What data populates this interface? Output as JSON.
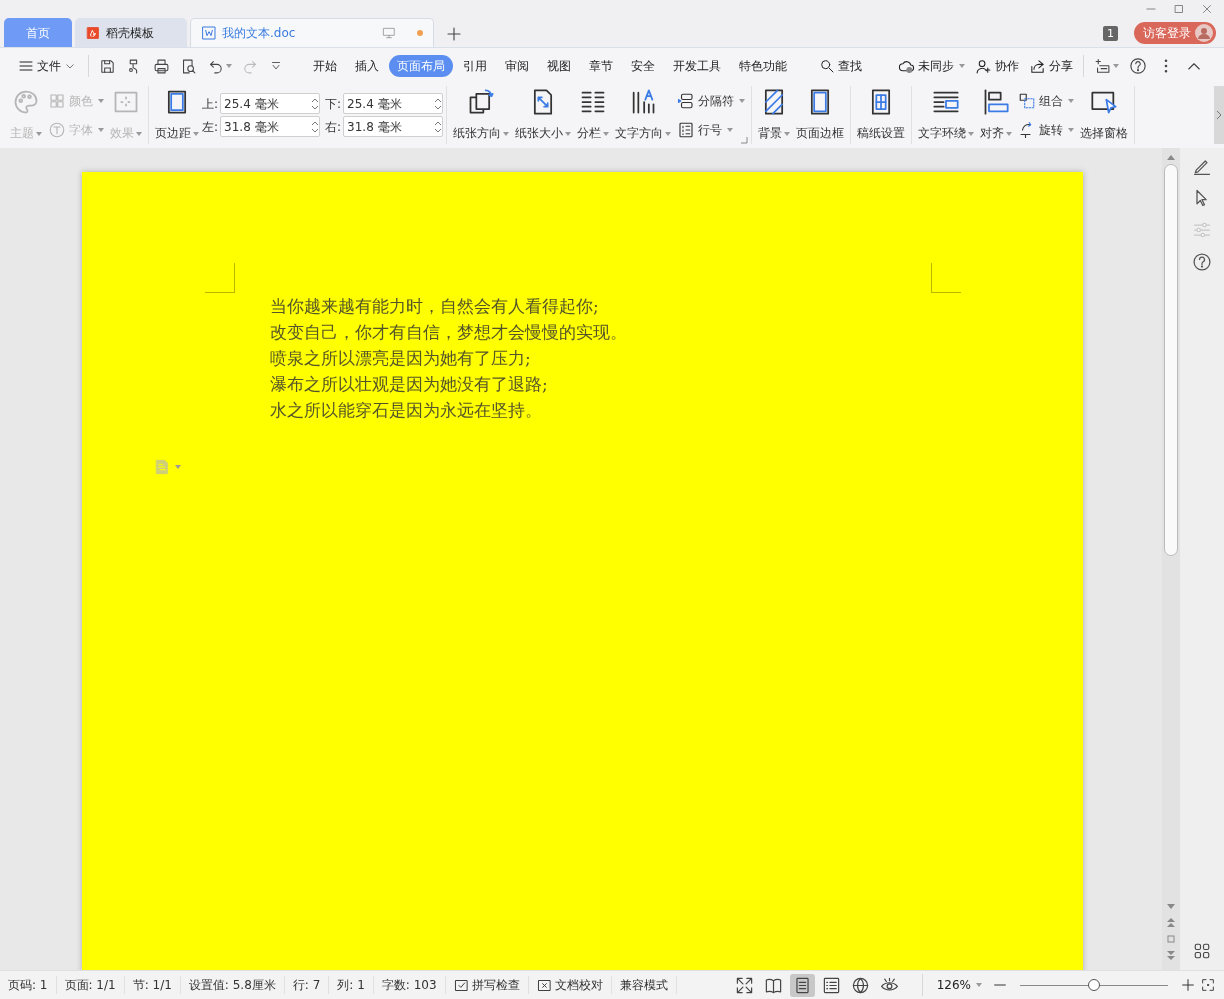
{
  "title_bar": {
    "tabs": [
      {
        "label": "首页",
        "kind": "home",
        "selected": false
      },
      {
        "label": "稻壳模板",
        "kind": "template",
        "selected": false
      },
      {
        "label": "我的文本.doc",
        "kind": "document",
        "selected": true,
        "unsaved": true
      }
    ],
    "badge": "1",
    "login_button": "访客登录"
  },
  "menu_bar": {
    "file_menu": "文件",
    "tabs": [
      {
        "label": "开始",
        "selected": false
      },
      {
        "label": "插入",
        "selected": false
      },
      {
        "label": "页面布局",
        "selected": true
      },
      {
        "label": "引用",
        "selected": false
      },
      {
        "label": "审阅",
        "selected": false
      },
      {
        "label": "视图",
        "selected": false
      },
      {
        "label": "章节",
        "selected": false
      },
      {
        "label": "安全",
        "selected": false
      },
      {
        "label": "开发工具",
        "selected": false
      },
      {
        "label": "特色功能",
        "selected": false
      }
    ],
    "search": "查找",
    "actions": [
      {
        "label": "未同步",
        "kind": "sync",
        "dropdown": true
      },
      {
        "label": "协作",
        "kind": "collab",
        "dropdown": false
      },
      {
        "label": "分享",
        "kind": "share",
        "dropdown": false
      }
    ]
  },
  "ribbon": {
    "groups": [
      {
        "launcher": false,
        "items": [
          {
            "kind": "palette",
            "label": "主题",
            "dropdown": true,
            "disabled": true
          },
          {
            "rows": [
              {
                "kind": "grid",
                "label": "颜色",
                "dropdown": true,
                "disabled": true
              },
              {
                "kind": "font",
                "label": "字体",
                "dropdown": true,
                "disabled": true
              }
            ]
          },
          {
            "kind": "effect",
            "label": "效果",
            "dropdown": true,
            "disabled": true
          }
        ]
      },
      {
        "launcher": false,
        "items": [
          {
            "kind": "margins",
            "label": "页边距",
            "dropdown": true,
            "disabled": false
          },
          {
            "fields": [
              {
                "label": "上:",
                "value": "25.4 毫米"
              },
              {
                "label": "下:",
                "value": "25.4 毫米"
              },
              {
                "label": "左:",
                "value": "31.8 毫米"
              },
              {
                "label": "右:",
                "value": "31.8 毫米"
              }
            ]
          }
        ]
      },
      {
        "launcher": true,
        "items": [
          {
            "kind": "orientation",
            "label": "纸张方向",
            "dropdown": true,
            "disabled": false
          },
          {
            "kind": "size",
            "label": "纸张大小",
            "dropdown": true,
            "disabled": false
          },
          {
            "kind": "columns",
            "label": "分栏",
            "dropdown": true,
            "disabled": false
          },
          {
            "kind": "textdir",
            "label": "文字方向",
            "dropdown": true,
            "disabled": false
          },
          {
            "rows": [
              {
                "kind": "separator",
                "label": "分隔符",
                "dropdown": true,
                "disabled": false
              },
              {
                "kind": "linenum",
                "label": "行号",
                "dropdown": true,
                "disabled": false
              }
            ]
          }
        ]
      },
      {
        "launcher": false,
        "items": [
          {
            "kind": "background",
            "label": "背景",
            "dropdown": true,
            "disabled": false
          },
          {
            "kind": "border",
            "label": "页面边框",
            "dropdown": false,
            "disabled": false
          }
        ]
      },
      {
        "launcher": false,
        "items": [
          {
            "kind": "gridpaper",
            "label": "稿纸设置",
            "dropdown": false,
            "disabled": false
          }
        ]
      },
      {
        "launcher": false,
        "items": [
          {
            "kind": "wrap",
            "label": "文字环绕",
            "dropdown": true,
            "disabled": false
          },
          {
            "kind": "align",
            "label": "对齐",
            "dropdown": true,
            "disabled": false
          },
          {
            "rows": [
              {
                "kind": "group",
                "label": "组合",
                "dropdown": true,
                "disabled": false
              },
              {
                "kind": "rotate",
                "label": "旋转",
                "dropdown": true,
                "disabled": false
              }
            ]
          },
          {
            "kind": "pane",
            "label": "选择窗格",
            "dropdown": false,
            "disabled": false
          }
        ]
      }
    ]
  },
  "document": {
    "paragraphs": [
      "当你越来越有能力时，自然会有人看得起你;",
      "改变自己，你才有自信，梦想才会慢慢的实现。",
      "喷泉之所以漂亮是因为她有了压力;",
      "瀑布之所以壮观是因为她没有了退路;",
      "水之所以能穿石是因为永远在坚持。"
    ]
  },
  "side_panel": {
    "tools": [
      {
        "kind": "pen",
        "disabled": false
      },
      {
        "kind": "cursor",
        "disabled": false
      },
      {
        "kind": "sliders",
        "disabled": true
      },
      {
        "kind": "help",
        "disabled": false
      }
    ]
  },
  "status_bar": {
    "items": [
      {
        "label": "页码: 1",
        "kind": "text"
      },
      {
        "label": "页面: 1/1",
        "kind": "text"
      },
      {
        "label": "节: 1/1",
        "kind": "text"
      },
      {
        "label": "设置值: 5.8厘米",
        "kind": "text"
      },
      {
        "label": "行: 7",
        "kind": "text"
      },
      {
        "label": "列: 1",
        "kind": "text"
      },
      {
        "label": "字数: 103",
        "kind": "text"
      },
      {
        "label": "拼写检查",
        "kind": "spell"
      },
      {
        "label": "文档校对",
        "kind": "proof"
      },
      {
        "label": "兼容模式",
        "kind": "text"
      }
    ],
    "views": [
      {
        "kind": "fullscreen",
        "selected": false
      },
      {
        "kind": "read",
        "selected": false
      },
      {
        "kind": "page",
        "selected": true
      },
      {
        "kind": "outline",
        "selected": false
      },
      {
        "kind": "web",
        "selected": false
      },
      {
        "kind": "eye",
        "selected": false
      }
    ],
    "zoom": {
      "value": "126%",
      "level": 0.5
    }
  }
}
